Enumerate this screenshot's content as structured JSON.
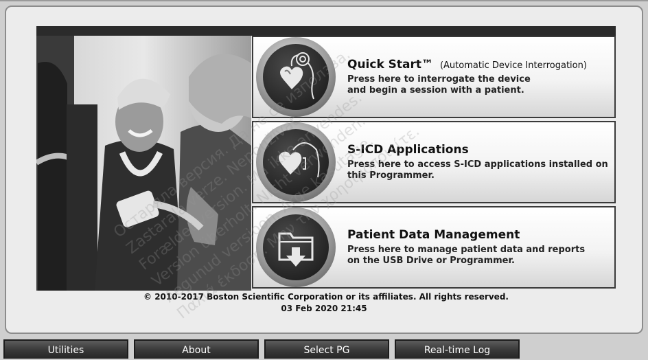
{
  "menu": {
    "items": [
      {
        "title": "Quick Start™",
        "subtitle": "(Automatic Device Interrogation)",
        "lines": [
          "Press here to interrogate the device",
          "and begin a session with a patient."
        ]
      },
      {
        "title": "S-ICD Applications",
        "subtitle": "",
        "lines": [
          "Press here to access S-ICD applications installed on",
          "this Programmer."
        ]
      },
      {
        "title": "Patient Data Management",
        "subtitle": "",
        "lines": [
          "Press here to manage patient data and reports",
          "on the USB Drive or Programmer."
        ]
      }
    ]
  },
  "footer": {
    "copyright": "© 2010-2017 Boston Scientific Corporation or its affiliates. All rights reserved.",
    "datetime": "03 Feb 2020 21:45"
  },
  "toolbar": {
    "buttons": [
      "Utilities",
      "About",
      "Select PG",
      "Real-time Log"
    ]
  },
  "icons": {
    "quick_start": "heart-device-lead-icon",
    "sicd": "heart-sicd-icon",
    "patient_data": "folder-download-icon"
  },
  "watermark": {
    "lines": [
      "Остаряла версия. Да не се използва.",
      "Zastaralá verze. Nepoužívat.",
      "Forældet version. Må ikke anvendes.",
      "Version überholt. Nicht verwenden.",
      "Aegunud versioon. Ärge kasutage.",
      "Παλιά έκδοση. Μην την χρησιμοποιείτε."
    ]
  }
}
